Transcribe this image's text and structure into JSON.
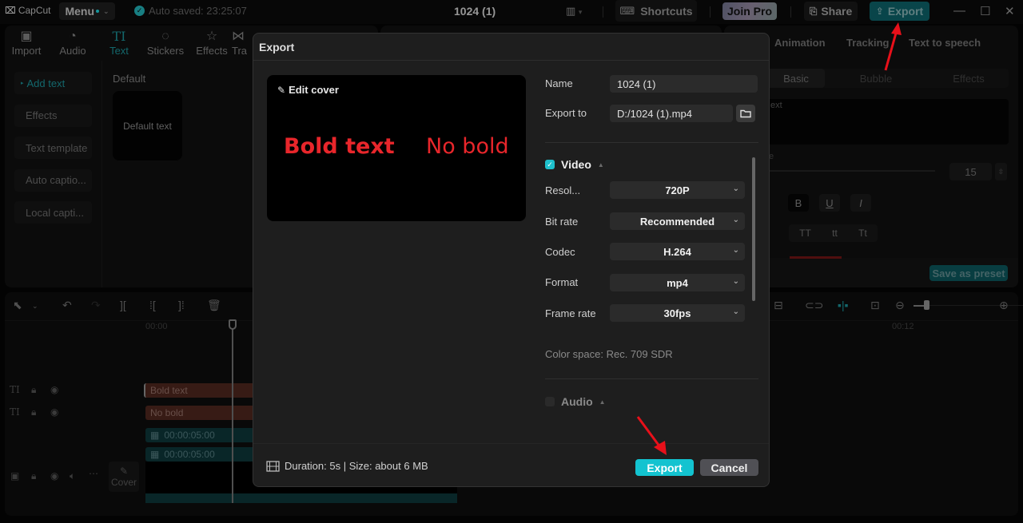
{
  "titlebar": {
    "app_name": "CapCut",
    "menu_label": "Menu",
    "autosave_text": "Auto saved: 23:25:07",
    "project_title": "1024 (1)",
    "shortcuts_label": "Shortcuts",
    "join_pro_label": "Join Pro",
    "share_label": "Share",
    "export_label": "Export"
  },
  "media_panel": {
    "tabs": [
      {
        "label": "Import",
        "icon": "import-icon"
      },
      {
        "label": "Audio",
        "icon": "audio-icon"
      },
      {
        "label": "Text",
        "icon": "text-icon",
        "active": true
      },
      {
        "label": "Stickers",
        "icon": "stickers-icon"
      },
      {
        "label": "Effects",
        "icon": "effects-icon"
      },
      {
        "label": "Tra",
        "icon": "transitions-icon"
      }
    ],
    "side_items": [
      {
        "label": "Add text",
        "active": true
      },
      {
        "label": "Effects"
      },
      {
        "label": "Text template"
      },
      {
        "label": "Auto captio..."
      },
      {
        "label": "Local capti..."
      }
    ],
    "section_label": "Default",
    "card_label": "Default text"
  },
  "props_panel": {
    "tabs": [
      "Animation",
      "Tracking",
      "Text to speech"
    ],
    "subtabs": [
      "Basic",
      "Bubble",
      "Effects"
    ],
    "text_preview": "ext",
    "size_label": "e",
    "font_size": "15",
    "style_buttons": [
      "B",
      "U",
      "I"
    ],
    "case_buttons": [
      "TT",
      "tt",
      "Tt"
    ],
    "save_preset_label": "Save as preset"
  },
  "timeline": {
    "ruler_start": "00:00",
    "ruler_mid": "00:12",
    "tracks": [
      {
        "type": "text",
        "clip_label": "Bold text"
      },
      {
        "type": "text",
        "clip_label": "No bold"
      },
      {
        "type": "video",
        "clip_label": "00:00:05:00"
      },
      {
        "type": "video",
        "clip_label": "00:00:05:00"
      }
    ],
    "cover_label": "Cover"
  },
  "export_dialog": {
    "title": "Export",
    "edit_cover_label": "Edit cover",
    "cover_texts": [
      "Bold text",
      "No bold"
    ],
    "name_label": "Name",
    "name_value": "1024 (1)",
    "export_to_label": "Export to",
    "export_to_value": "D:/1024 (1).mp4",
    "video_section": {
      "label": "Video",
      "checked": true,
      "fields": [
        {
          "label": "Resol...",
          "value": "720P"
        },
        {
          "label": "Bit rate",
          "value": "Recommended"
        },
        {
          "label": "Codec",
          "value": "H.264"
        },
        {
          "label": "Format",
          "value": "mp4"
        },
        {
          "label": "Frame rate",
          "value": "30fps"
        }
      ],
      "color_space": "Color space: Rec. 709 SDR"
    },
    "audio_section": {
      "label": "Audio",
      "checked": false
    },
    "footer": {
      "duration_text": "Duration: 5s | Size: about 6 MB",
      "export_label": "Export",
      "cancel_label": "Cancel"
    }
  },
  "colors": {
    "accent": "#13c3d0",
    "annotation_arrow": "#e8101a",
    "cover_text": "#e8262b"
  }
}
